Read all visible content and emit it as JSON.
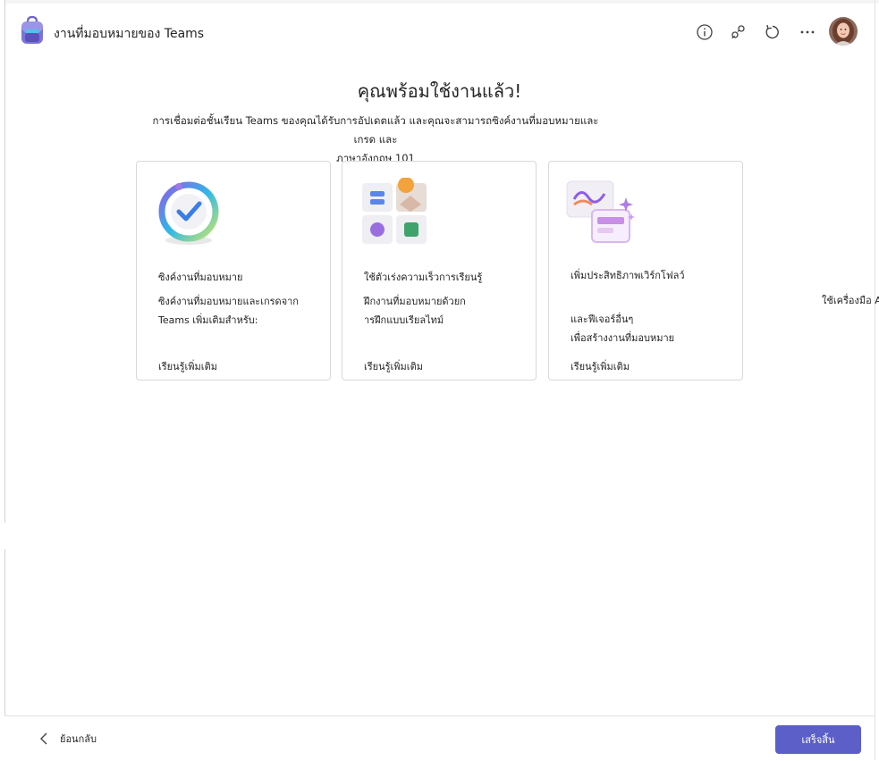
{
  "header": {
    "app_title": "งานที่มอบหมายของ Teams",
    "actions": {
      "info": "info-icon",
      "share": "share-icon",
      "refresh": "refresh-icon",
      "more": "more-icon"
    }
  },
  "main": {
    "headline": "คุณพร้อมใช้งานแล้ว!",
    "subtitle_line1": "การเชื่อมต่อชั้นเรียน Teams ของคุณได้รับการอัปเดตแล้ว และคุณจะสามารถซิงค์งานที่มอบหมายและเกรด และ",
    "subtitle_line2": "ภาษาอังกฤษ 101",
    "cards": [
      {
        "title": "ซิงค์งานที่มอบหมาย",
        "desc_line1": "ซิงค์งานที่มอบหมายและเกรดจาก",
        "desc_line2": "Teams เพิ่มเติมสำหรับ:",
        "link": "เรียนรู้เพิ่มเติม"
      },
      {
        "title": "ใช้ตัวเร่งความเร็วการเรียนรู้",
        "desc_line1": "ฝึกงานที่มอบหมายด้วยก",
        "desc_line2": "ารฝึกแบบเรียลไทม์",
        "link": "เรียนรู้เพิ่มเติม"
      },
      {
        "title": "เพิ่มประสิทธิภาพเวิร์กโฟลว์",
        "desc_line1": "และฟีเจอร์อื่นๆ",
        "desc_line2": "เพื่อสร้างงานที่มอบหมาย",
        "link": "เรียนรู้เพิ่มเติม"
      }
    ],
    "overflow_text": "ใช้เครื่องมือ AI"
  },
  "footer": {
    "back_label": "ย้อนกลับ",
    "finish_label": "เสร็จสิ้น"
  },
  "colors": {
    "accent": "#5b5fc7",
    "text": "#242424",
    "border": "#d8d8d8"
  }
}
